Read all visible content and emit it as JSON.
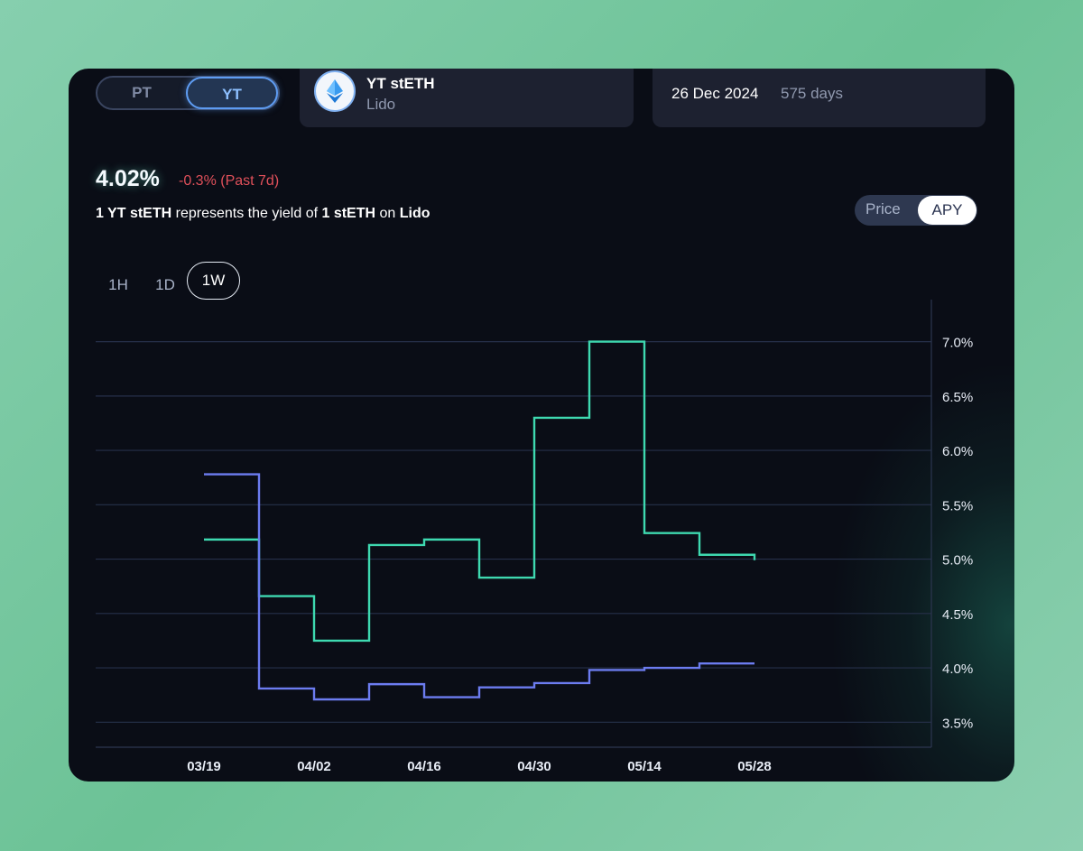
{
  "toggle": {
    "pt_label": "PT",
    "yt_label": "YT",
    "selected": "YT"
  },
  "asset": {
    "name": "YT stETH",
    "protocol": "Lido",
    "icon": "lido-drop-icon"
  },
  "maturity": {
    "date": "26 Dec 2024",
    "days": "575 days"
  },
  "summary": {
    "apy": "4.02%",
    "change": "-0.3% (Past 7d)",
    "desc_amount1": "1 YT stETH",
    "desc_text1": " represents the yield of ",
    "desc_amount2": "1 stETH",
    "desc_text2": " on ",
    "desc_protocol": "Lido"
  },
  "mode": {
    "price_label": "Price",
    "apy_label": "APY",
    "selected": "APY"
  },
  "timeframes": {
    "h1": "1H",
    "d1": "1D",
    "w1": "1W",
    "selected": "1W"
  },
  "colors": {
    "implied_apy": "#3ed9b0",
    "underlying_apy": "#6c7cf0",
    "accent": "#5e9cf2",
    "negative": "#e0505a"
  },
  "chart_data": {
    "type": "line",
    "step": true,
    "x": [
      "03/19",
      "03/26",
      "04/02",
      "04/09",
      "04/16",
      "04/23",
      "04/30",
      "05/07",
      "05/14",
      "05/21",
      "05/28"
    ],
    "x_tick_labels": [
      "03/19",
      "04/02",
      "04/16",
      "04/30",
      "05/14",
      "05/28"
    ],
    "y_tick_labels": [
      "7.0%",
      "6.5%",
      "6.0%",
      "5.5%",
      "5.0%",
      "4.5%",
      "4.0%",
      "3.5%"
    ],
    "ylim": [
      3.27,
      7.42
    ],
    "y_unit": "%",
    "grid": true,
    "y_axis_position": "right",
    "series": [
      {
        "color": "#3ed9b0",
        "values": [
          5.18,
          4.66,
          4.25,
          5.13,
          5.18,
          4.83,
          6.3,
          7.0,
          5.24,
          5.04,
          4.99
        ]
      },
      {
        "color": "#6c7cf0",
        "values": [
          5.78,
          3.81,
          3.71,
          3.85,
          3.73,
          3.82,
          3.86,
          3.98,
          4.0,
          4.04,
          4.04
        ]
      }
    ]
  }
}
